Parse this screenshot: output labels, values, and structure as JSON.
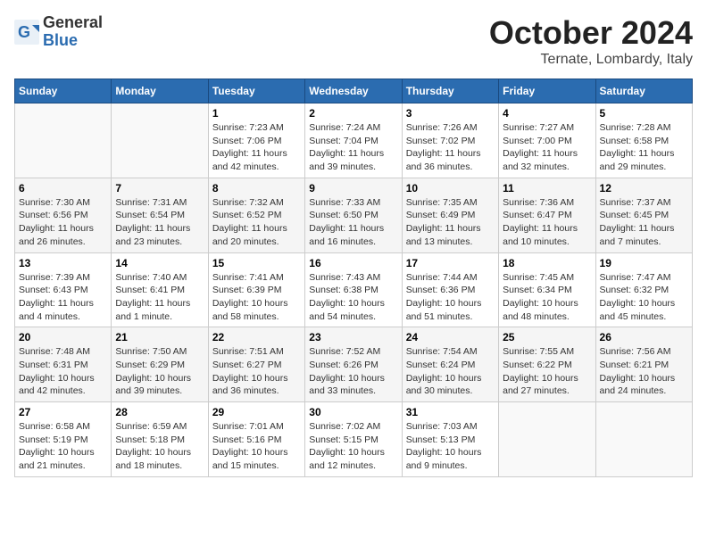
{
  "header": {
    "logo": {
      "general": "General",
      "blue": "Blue"
    },
    "title": "October 2024",
    "subtitle": "Ternate, Lombardy, Italy"
  },
  "calendar": {
    "days_of_week": [
      "Sunday",
      "Monday",
      "Tuesday",
      "Wednesday",
      "Thursday",
      "Friday",
      "Saturday"
    ],
    "weeks": [
      [
        {
          "day": "",
          "info": ""
        },
        {
          "day": "",
          "info": ""
        },
        {
          "day": "1",
          "info": "Sunrise: 7:23 AM\nSunset: 7:06 PM\nDaylight: 11 hours\nand 42 minutes."
        },
        {
          "day": "2",
          "info": "Sunrise: 7:24 AM\nSunset: 7:04 PM\nDaylight: 11 hours\nand 39 minutes."
        },
        {
          "day": "3",
          "info": "Sunrise: 7:26 AM\nSunset: 7:02 PM\nDaylight: 11 hours\nand 36 minutes."
        },
        {
          "day": "4",
          "info": "Sunrise: 7:27 AM\nSunset: 7:00 PM\nDaylight: 11 hours\nand 32 minutes."
        },
        {
          "day": "5",
          "info": "Sunrise: 7:28 AM\nSunset: 6:58 PM\nDaylight: 11 hours\nand 29 minutes."
        }
      ],
      [
        {
          "day": "6",
          "info": "Sunrise: 7:30 AM\nSunset: 6:56 PM\nDaylight: 11 hours\nand 26 minutes."
        },
        {
          "day": "7",
          "info": "Sunrise: 7:31 AM\nSunset: 6:54 PM\nDaylight: 11 hours\nand 23 minutes."
        },
        {
          "day": "8",
          "info": "Sunrise: 7:32 AM\nSunset: 6:52 PM\nDaylight: 11 hours\nand 20 minutes."
        },
        {
          "day": "9",
          "info": "Sunrise: 7:33 AM\nSunset: 6:50 PM\nDaylight: 11 hours\nand 16 minutes."
        },
        {
          "day": "10",
          "info": "Sunrise: 7:35 AM\nSunset: 6:49 PM\nDaylight: 11 hours\nand 13 minutes."
        },
        {
          "day": "11",
          "info": "Sunrise: 7:36 AM\nSunset: 6:47 PM\nDaylight: 11 hours\nand 10 minutes."
        },
        {
          "day": "12",
          "info": "Sunrise: 7:37 AM\nSunset: 6:45 PM\nDaylight: 11 hours\nand 7 minutes."
        }
      ],
      [
        {
          "day": "13",
          "info": "Sunrise: 7:39 AM\nSunset: 6:43 PM\nDaylight: 11 hours\nand 4 minutes."
        },
        {
          "day": "14",
          "info": "Sunrise: 7:40 AM\nSunset: 6:41 PM\nDaylight: 11 hours\nand 1 minute."
        },
        {
          "day": "15",
          "info": "Sunrise: 7:41 AM\nSunset: 6:39 PM\nDaylight: 10 hours\nand 58 minutes."
        },
        {
          "day": "16",
          "info": "Sunrise: 7:43 AM\nSunset: 6:38 PM\nDaylight: 10 hours\nand 54 minutes."
        },
        {
          "day": "17",
          "info": "Sunrise: 7:44 AM\nSunset: 6:36 PM\nDaylight: 10 hours\nand 51 minutes."
        },
        {
          "day": "18",
          "info": "Sunrise: 7:45 AM\nSunset: 6:34 PM\nDaylight: 10 hours\nand 48 minutes."
        },
        {
          "day": "19",
          "info": "Sunrise: 7:47 AM\nSunset: 6:32 PM\nDaylight: 10 hours\nand 45 minutes."
        }
      ],
      [
        {
          "day": "20",
          "info": "Sunrise: 7:48 AM\nSunset: 6:31 PM\nDaylight: 10 hours\nand 42 minutes."
        },
        {
          "day": "21",
          "info": "Sunrise: 7:50 AM\nSunset: 6:29 PM\nDaylight: 10 hours\nand 39 minutes."
        },
        {
          "day": "22",
          "info": "Sunrise: 7:51 AM\nSunset: 6:27 PM\nDaylight: 10 hours\nand 36 minutes."
        },
        {
          "day": "23",
          "info": "Sunrise: 7:52 AM\nSunset: 6:26 PM\nDaylight: 10 hours\nand 33 minutes."
        },
        {
          "day": "24",
          "info": "Sunrise: 7:54 AM\nSunset: 6:24 PM\nDaylight: 10 hours\nand 30 minutes."
        },
        {
          "day": "25",
          "info": "Sunrise: 7:55 AM\nSunset: 6:22 PM\nDaylight: 10 hours\nand 27 minutes."
        },
        {
          "day": "26",
          "info": "Sunrise: 7:56 AM\nSunset: 6:21 PM\nDaylight: 10 hours\nand 24 minutes."
        }
      ],
      [
        {
          "day": "27",
          "info": "Sunrise: 6:58 AM\nSunset: 5:19 PM\nDaylight: 10 hours\nand 21 minutes."
        },
        {
          "day": "28",
          "info": "Sunrise: 6:59 AM\nSunset: 5:18 PM\nDaylight: 10 hours\nand 18 minutes."
        },
        {
          "day": "29",
          "info": "Sunrise: 7:01 AM\nSunset: 5:16 PM\nDaylight: 10 hours\nand 15 minutes."
        },
        {
          "day": "30",
          "info": "Sunrise: 7:02 AM\nSunset: 5:15 PM\nDaylight: 10 hours\nand 12 minutes."
        },
        {
          "day": "31",
          "info": "Sunrise: 7:03 AM\nSunset: 5:13 PM\nDaylight: 10 hours\nand 9 minutes."
        },
        {
          "day": "",
          "info": ""
        },
        {
          "day": "",
          "info": ""
        }
      ]
    ]
  }
}
